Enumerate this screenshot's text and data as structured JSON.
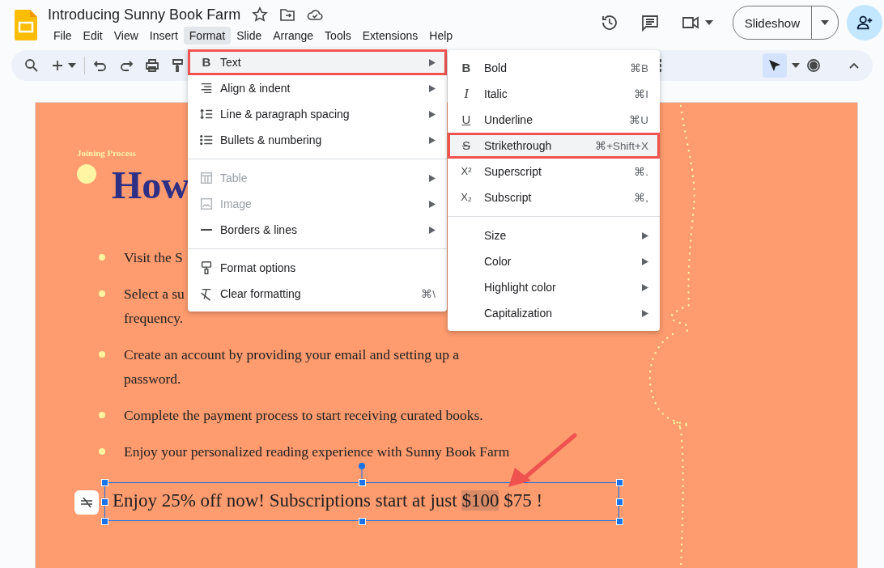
{
  "document": {
    "title": "Introducing Sunny Book Farm"
  },
  "menu_bar": [
    {
      "label": "File",
      "selected": false
    },
    {
      "label": "Edit",
      "selected": false
    },
    {
      "label": "View",
      "selected": false
    },
    {
      "label": "Insert",
      "selected": false
    },
    {
      "label": "Format",
      "selected": true
    },
    {
      "label": "Slide",
      "selected": false
    },
    {
      "label": "Arrange",
      "selected": false
    },
    {
      "label": "Tools",
      "selected": false
    },
    {
      "label": "Extensions",
      "selected": false
    },
    {
      "label": "Help",
      "selected": false
    }
  ],
  "slideshow_button": {
    "label": "Slideshow"
  },
  "format_menu": {
    "items": [
      {
        "kind": "bold",
        "label": "Text",
        "glyph": "B",
        "selected": true,
        "disabled": false,
        "submenu": true
      },
      {
        "kind": "align",
        "label": "Align & indent",
        "selected": false,
        "disabled": false,
        "submenu": true
      },
      {
        "kind": "spacing",
        "label": "Line & paragraph spacing",
        "selected": false,
        "disabled": false,
        "submenu": true
      },
      {
        "kind": "bullets",
        "label": "Bullets & numbering",
        "selected": false,
        "disabled": false,
        "submenu": true
      },
      {
        "kind": "divider"
      },
      {
        "kind": "table",
        "label": "Table",
        "selected": false,
        "disabled": true,
        "submenu": true
      },
      {
        "kind": "image",
        "label": "Image",
        "selected": false,
        "disabled": true,
        "submenu": true
      },
      {
        "kind": "line",
        "label": "Borders & lines",
        "selected": false,
        "disabled": false,
        "submenu": true
      },
      {
        "kind": "divider"
      },
      {
        "kind": "paint",
        "label": "Format options",
        "selected": false,
        "disabled": false,
        "submenu": false
      },
      {
        "kind": "clear",
        "label": "Clear formatting",
        "shortcut": "⌘\\",
        "selected": false,
        "disabled": false,
        "submenu": false
      }
    ]
  },
  "text_submenu": {
    "items": [
      {
        "kind": "bold",
        "label": "Bold",
        "glyph": "B",
        "shortcut": "⌘B",
        "selected": false,
        "submenu": false
      },
      {
        "kind": "italic",
        "label": "Italic",
        "glyph": "I",
        "shortcut": "⌘I",
        "selected": false,
        "submenu": false
      },
      {
        "kind": "underline",
        "label": "Underline",
        "glyph": "U",
        "shortcut": "⌘U",
        "selected": false,
        "submenu": false
      },
      {
        "kind": "strike",
        "label": "Strikethrough",
        "glyph": "S",
        "shortcut": "⌘+Shift+X",
        "selected": true,
        "submenu": false
      },
      {
        "kind": "superscript",
        "label": "Superscript",
        "glyph": "X²",
        "shortcut": "⌘.",
        "selected": false,
        "submenu": false
      },
      {
        "kind": "subscript",
        "label": "Subscript",
        "glyph": "X₂",
        "shortcut": "⌘,",
        "selected": false,
        "submenu": false
      },
      {
        "kind": "divider"
      },
      {
        "kind": "plain",
        "label": "Size",
        "selected": false,
        "submenu": true
      },
      {
        "kind": "plain",
        "label": "Color",
        "selected": false,
        "submenu": true
      },
      {
        "kind": "plain",
        "label": "Highlight color",
        "selected": false,
        "submenu": true
      },
      {
        "kind": "plain",
        "label": "Capitalization",
        "selected": false,
        "submenu": true
      }
    ]
  },
  "slide": {
    "eyebrow": "Joining Process",
    "heading": "How",
    "bullets": [
      {
        "lines": [
          "Visit the S"
        ]
      },
      {
        "lines": [
          "Select a su",
          "frequency."
        ]
      },
      {
        "lines": [
          "Create an account by providing your email and setting up a",
          "password."
        ]
      },
      {
        "lines": [
          "Complete the payment process to start receiving curated books."
        ]
      },
      {
        "lines": [
          "Enjoy your personalized reading experience with Sunny Book Farm"
        ]
      }
    ],
    "promo": {
      "segments": [
        {
          "text": "Enjoy 25% off now! Subscriptions start at just ",
          "selected": false
        },
        {
          "text": "$100",
          "selected": true
        },
        {
          "text": " $75 !",
          "selected": false
        }
      ]
    }
  }
}
